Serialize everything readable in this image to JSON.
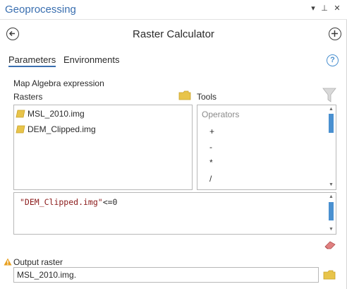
{
  "pane": {
    "title": "Geoprocessing",
    "menu_glyph": "▾",
    "pin_glyph": "⊥",
    "close_glyph": "✕"
  },
  "tool": {
    "title": "Raster Calculator"
  },
  "tabs": [
    {
      "label": "Parameters",
      "active": true
    },
    {
      "label": "Environments",
      "active": false
    }
  ],
  "help_glyph": "?",
  "map_algebra": {
    "label": "Map Algebra expression",
    "rasters_label": "Rasters",
    "tools_label": "Tools",
    "rasters": [
      {
        "name": "MSL_2010.img"
      },
      {
        "name": "DEM_Clipped.img"
      }
    ],
    "operators_header": "Operators",
    "operators": [
      "+",
      "-",
      "*",
      "/"
    ],
    "expression": {
      "string_part": "\"DEM_Clipped.img\"",
      "operator_part": "<=0"
    }
  },
  "output": {
    "label": "Output raster",
    "value": "MSL_2010.img."
  },
  "colors": {
    "accent": "#3a6fb0",
    "scroll_thumb": "#4a90d0",
    "folder": "#e8c44a",
    "warning": "#e8a020",
    "expression_string": "#8b1a1a"
  }
}
